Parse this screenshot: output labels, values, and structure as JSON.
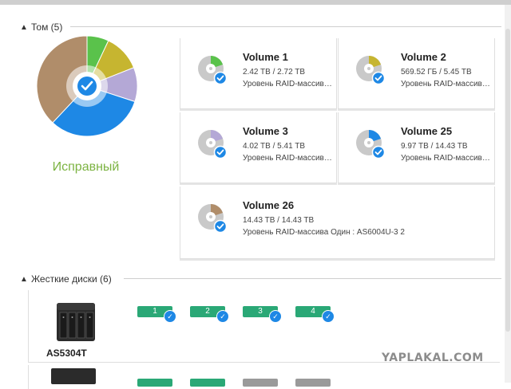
{
  "volumes_section": {
    "title": "Том (5)"
  },
  "health": {
    "label": "Исправный",
    "color": "#7cb342"
  },
  "pie_colors": [
    "#5ac24b",
    "#c6b530",
    "#b4a8d6",
    "#1e88e5",
    "#b08d6a"
  ],
  "volumes": [
    {
      "title": "Volume 1",
      "capacity": "2.42 TB / 2.72 TB",
      "raid": "Уровень RAID-массив…",
      "accent": "#5ac24b"
    },
    {
      "title": "Volume 2",
      "capacity": "569.52 ГБ / 5.45 ТВ",
      "raid": "Уровень RAID-массив…",
      "accent": "#c6b530"
    },
    {
      "title": "Volume 3",
      "capacity": "4.02 TB / 5.41 TB",
      "raid": "Уровень RAID-массив…",
      "accent": "#b4a8d6"
    },
    {
      "title": "Volume 25",
      "capacity": "9.97 TB / 14.43 TB",
      "raid": "Уровень RAID-массив…",
      "accent": "#1e88e5"
    },
    {
      "title": "Volume 26",
      "capacity": "14.43 TB / 14.43 TB",
      "raid": "Уровень RAID-массива Один : AS6004U-3 2",
      "accent": "#b08d6a"
    }
  ],
  "disks_section": {
    "title": "Жесткие диски (6)"
  },
  "nas_model": "AS5304T",
  "disk_slots": [
    "1",
    "2",
    "3",
    "4"
  ],
  "disk_color": "#2aa876",
  "check_color": "#1e88e5",
  "watermark": "YAPLAKAL.COM"
}
